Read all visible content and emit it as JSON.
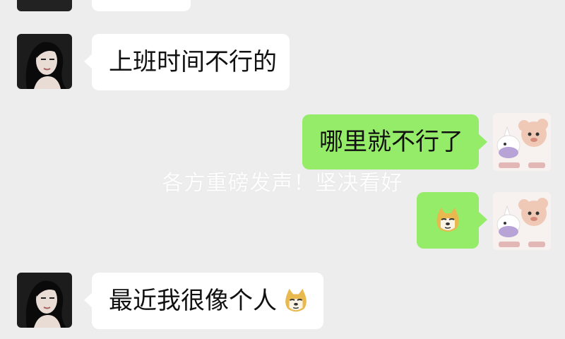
{
  "messages": [
    {
      "side": "in",
      "text": "上班时间不行的"
    },
    {
      "side": "out",
      "text": "哪里就不行了"
    },
    {
      "side": "out",
      "sticker": "doge-face-icon"
    },
    {
      "side": "in",
      "text": "最近我很像个人",
      "emoji": "doge-face-icon"
    }
  ],
  "watermark": "各方重磅发声！坚决看好",
  "colors": {
    "background": "#ededed",
    "incoming_bubble": "#ffffff",
    "outgoing_bubble": "#95ec69"
  }
}
